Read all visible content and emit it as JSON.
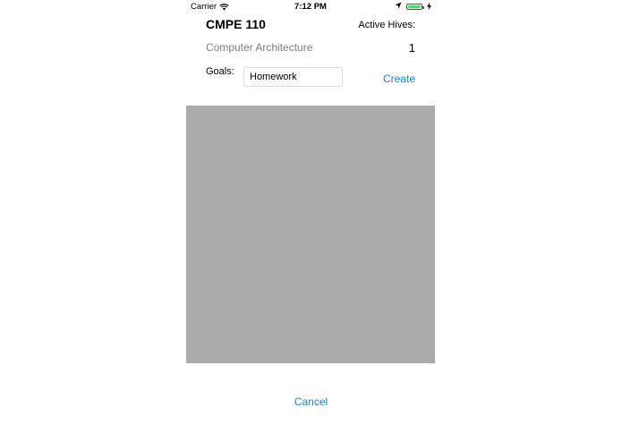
{
  "status_bar": {
    "carrier": "Carrier",
    "time": "7:12 PM",
    "battery_level": 1.0,
    "battery_color": "#4cd964"
  },
  "course": {
    "code": "CMPE 110",
    "name": "Computer Architecture"
  },
  "hives": {
    "label": "Active Hives:",
    "count": "1"
  },
  "goals": {
    "label": "Goals:",
    "value": "Homework"
  },
  "actions": {
    "create_label": "Create",
    "cancel_label": "Cancel"
  },
  "colors": {
    "accent": "#1a82e2",
    "map_placeholder": "#aaaaaa",
    "secondary_text": "#7d7d7d"
  }
}
